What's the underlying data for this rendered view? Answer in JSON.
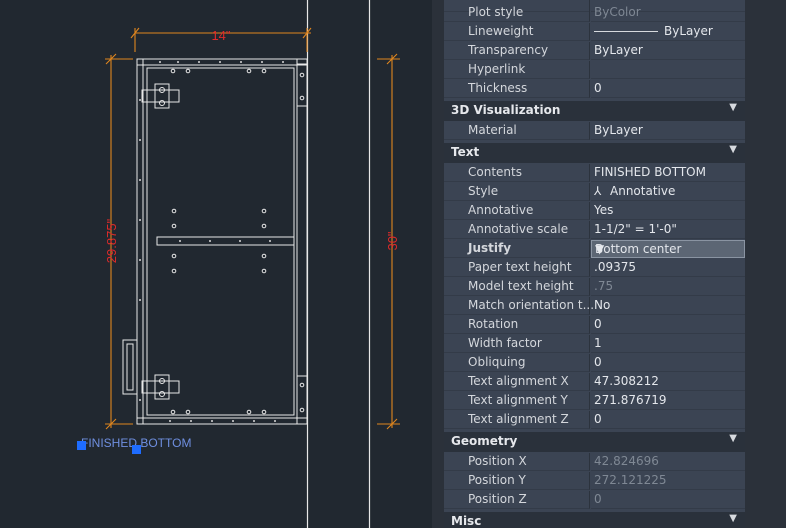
{
  "drawing": {
    "dim_width": "14\"",
    "dim_height_inner": "29.875\"",
    "dim_height_outer": "30\"",
    "text_entity": "FINISHED BOTTOM"
  },
  "colors": {
    "background": "#212830",
    "dimension": "#e0861e",
    "dimension_text": "#dd2a2a",
    "geometry": "#e8e8e8",
    "grip": "#1e6cff",
    "panel": "#3b4453"
  },
  "properties": {
    "general_partial": [
      {
        "label": "Plot style",
        "value": "ByColor",
        "dim": true
      },
      {
        "label": "Lineweight",
        "value": "ByLayer",
        "lineweight": true
      },
      {
        "label": "Transparency",
        "value": "ByLayer"
      },
      {
        "label": "Hyperlink",
        "value": ""
      },
      {
        "label": "Thickness",
        "value": "0"
      }
    ],
    "sections": {
      "viz": "3D Visualization",
      "text": "Text",
      "geometry": "Geometry",
      "misc": "Misc"
    },
    "viz": [
      {
        "label": "Material",
        "value": "ByLayer"
      }
    ],
    "text": [
      {
        "label": "Contents",
        "value": "FINISHED BOTTOM"
      },
      {
        "label": "Style",
        "value": "Annotative",
        "icon": "annotative-icon"
      },
      {
        "label": "Annotative",
        "value": "Yes"
      },
      {
        "label": "Annotative scale",
        "value": "1-1/2\" = 1'-0\""
      },
      {
        "label": "Justify",
        "value": "Bottom center",
        "selected": true
      },
      {
        "label": "Paper text height",
        "value": ".09375"
      },
      {
        "label": "Model text height",
        "value": ".75",
        "dim": true
      },
      {
        "label": "Match orientation t...",
        "value": "No"
      },
      {
        "label": "Rotation",
        "value": "0"
      },
      {
        "label": "Width factor",
        "value": "1"
      },
      {
        "label": "Obliquing",
        "value": "0"
      },
      {
        "label": "Text alignment X",
        "value": "47.308212"
      },
      {
        "label": "Text alignment Y",
        "value": "271.876719"
      },
      {
        "label": "Text alignment Z",
        "value": "0"
      }
    ],
    "geometry": [
      {
        "label": "Position X",
        "value": "42.824696",
        "dim": true
      },
      {
        "label": "Position Y",
        "value": "272.121225",
        "dim": true
      },
      {
        "label": "Position Z",
        "value": "0",
        "dim": true
      }
    ]
  }
}
